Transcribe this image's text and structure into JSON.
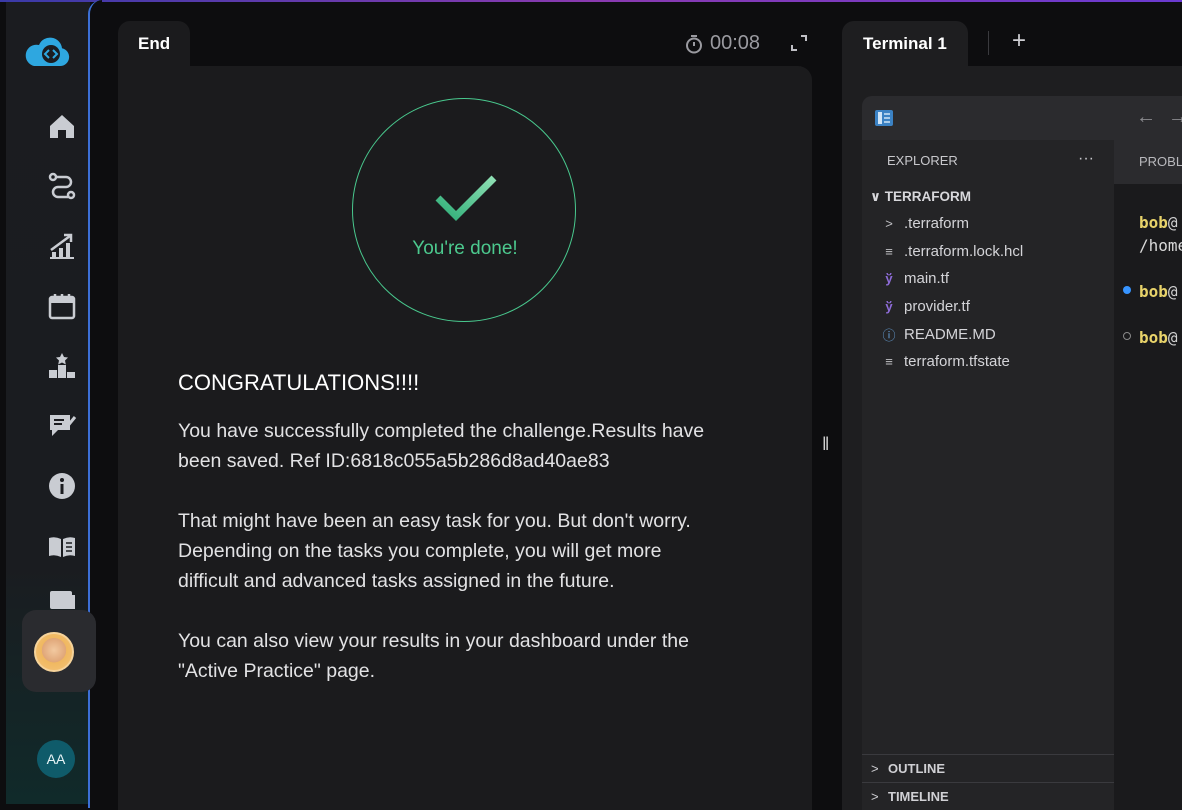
{
  "end_tab": {
    "label": "End"
  },
  "timer": {
    "value": "00:08"
  },
  "done": {
    "label": "You're done!"
  },
  "message": {
    "heading": "CONGRATULATIONS!!!!",
    "p1_line1": "You have successfully completed the challenge.Results have",
    "p1_line2": "been saved. Ref ID:6818c055a5b286d8ad40ae83",
    "p2_line1": "That might have been an easy task for you. But don't worry.",
    "p2_line2": "Depending on the tasks you complete, you will get more",
    "p2_line3": "difficult and advanced tasks assigned in the future.",
    "p3_line1": "You can also view your results in your dashboard under the",
    "p3_line2": "\"Active Practice\" page."
  },
  "sidebar": {
    "icons": [
      "cloud-code-logo",
      "home-icon",
      "route-icon",
      "growth-chart-icon",
      "calendar-icon",
      "leaderboard-icon",
      "notes-icon",
      "info-icon",
      "book-icon",
      "card-icon"
    ],
    "user_initials": "AA"
  },
  "terminal_tab": {
    "label": "Terminal 1",
    "add": "+"
  },
  "explorer": {
    "title": "EXPLORER",
    "more": "···",
    "root": "TERRAFORM",
    "items": [
      {
        "name": ".terraform",
        "icon": "chevron-right-icon"
      },
      {
        "name": ".terraform.lock.hcl",
        "icon": "lines-file-icon"
      },
      {
        "name": "main.tf",
        "icon": "terraform-icon"
      },
      {
        "name": "provider.tf",
        "icon": "terraform-icon"
      },
      {
        "name": "README.MD",
        "icon": "info-file-icon"
      },
      {
        "name": "terraform.tfstate",
        "icon": "lines-file-icon"
      }
    ],
    "outline": "OUTLINE",
    "timeline": "TIMELINE"
  },
  "panel_tab": {
    "label": "PROBLEMS"
  },
  "terminal": {
    "line1_user": "bob",
    "line1_rest": "@",
    "line2": "/home",
    "line3_user": "bob",
    "line3_rest": "@",
    "line4_user": "bob",
    "line4_rest": "@",
    "dot1_color": "#3794ff",
    "dot2_color": "#8a8a8a"
  },
  "colors": {
    "accent_green": "#4cc98e",
    "sidebar_edge": "#3c6fd6",
    "avatar_bg": "#0f5b6a"
  }
}
